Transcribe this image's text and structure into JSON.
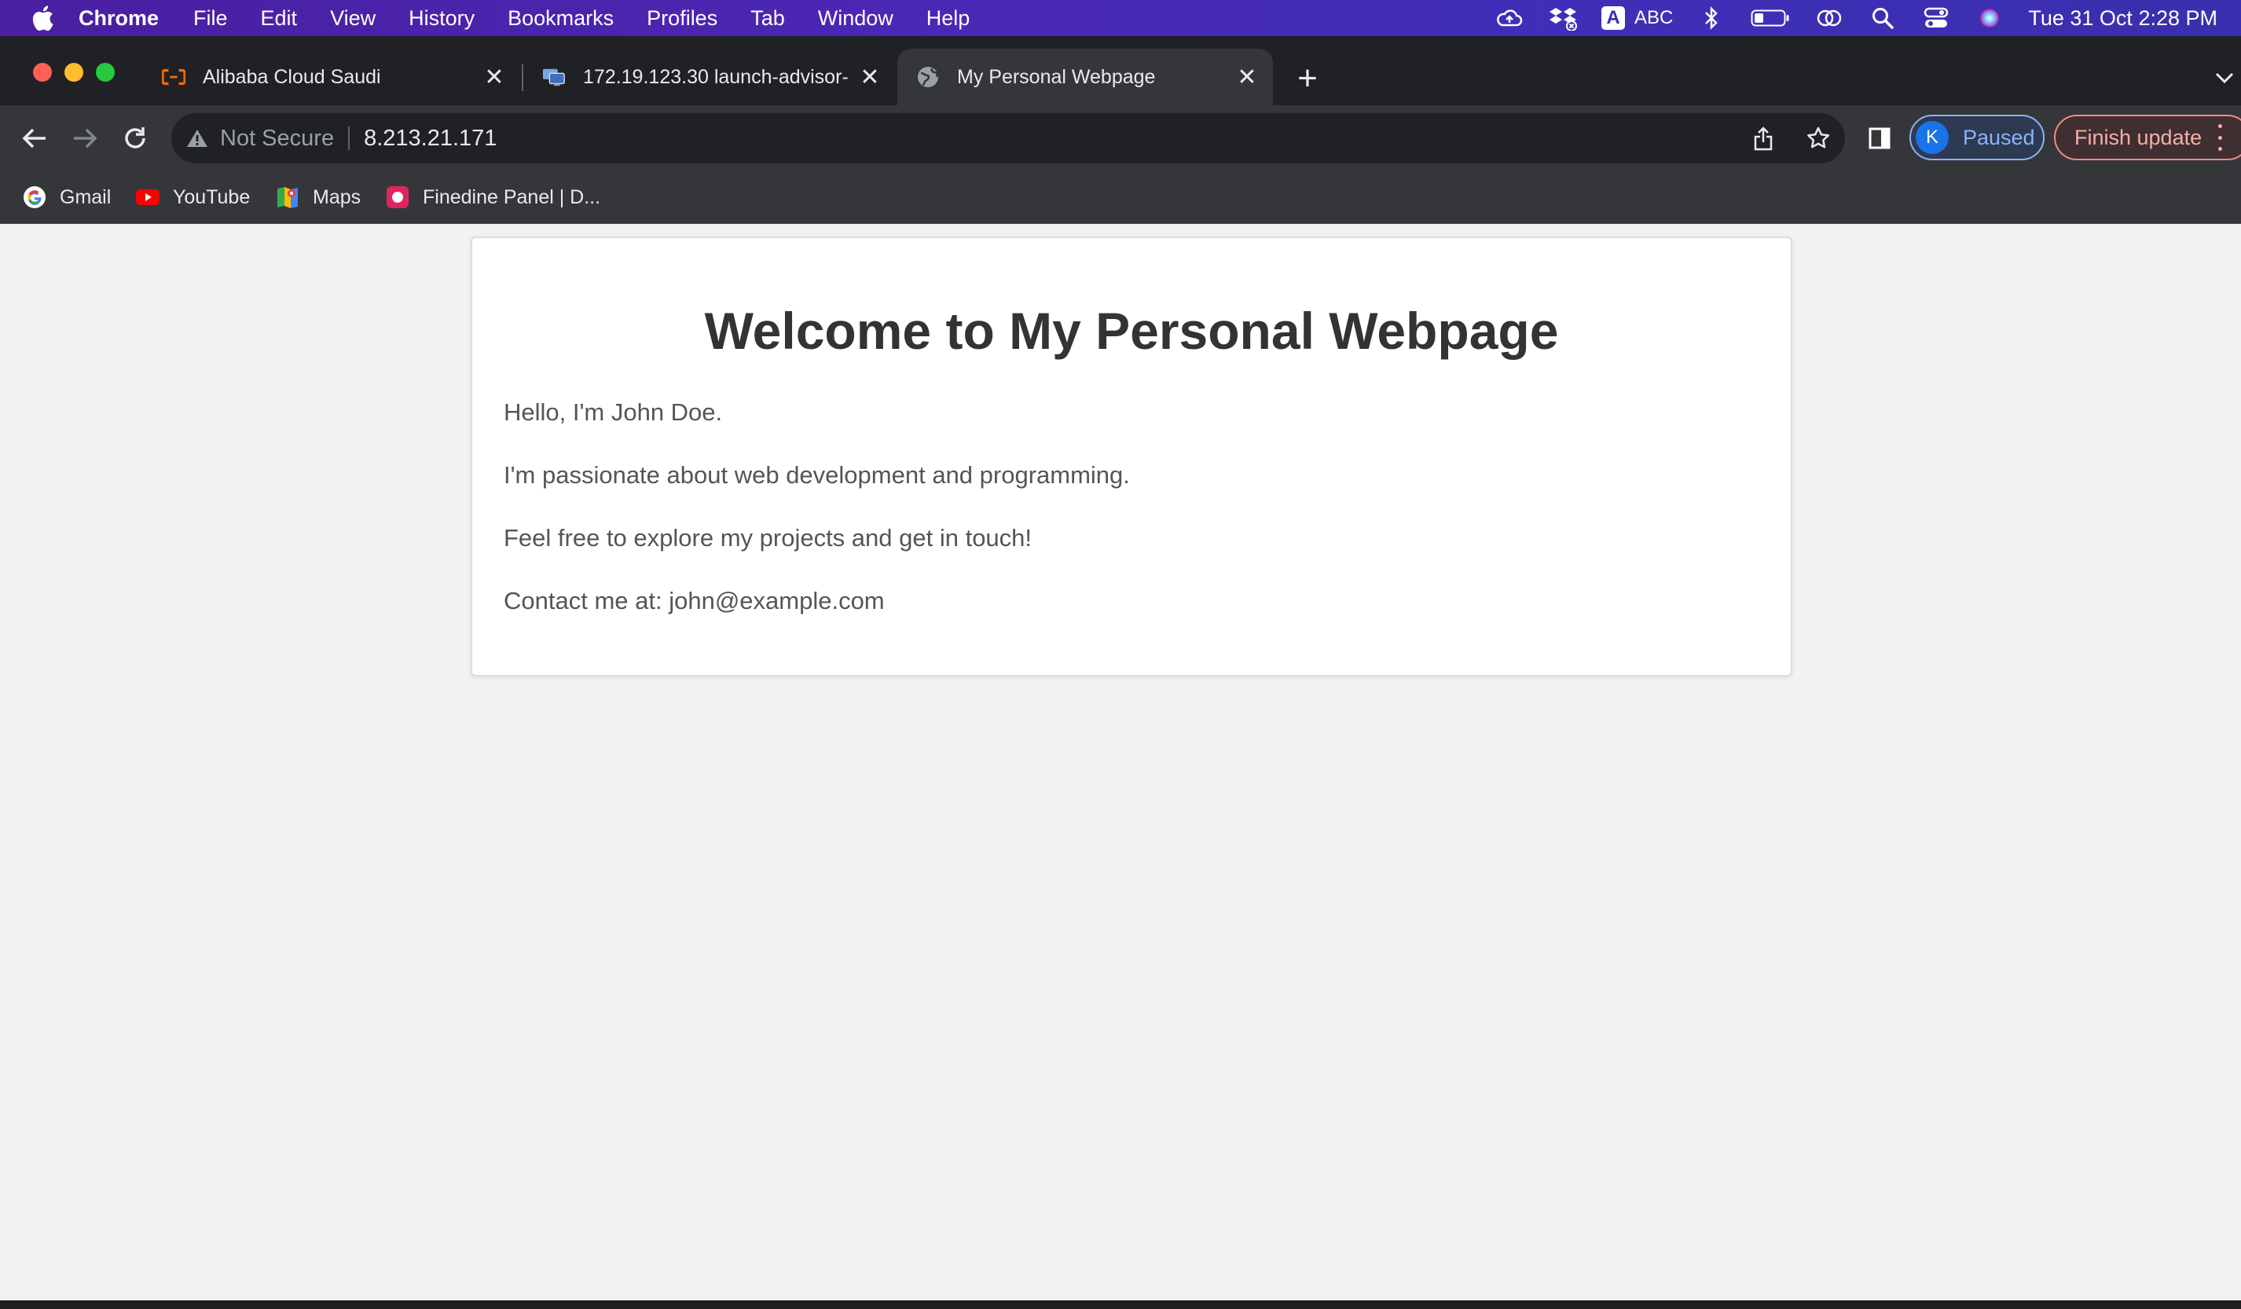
{
  "menubar": {
    "app_name": "Chrome",
    "menus": [
      "File",
      "Edit",
      "View",
      "History",
      "Bookmarks",
      "Profiles",
      "Tab",
      "Window",
      "Help"
    ],
    "keyboard_input": "ABC",
    "keyboard_badge": "A",
    "datetime": "Tue 31 Oct  2:28 PM"
  },
  "tabs": [
    {
      "title": "Alibaba Cloud Saudi",
      "icon": "alibaba-cloud-icon",
      "active": false
    },
    {
      "title": "172.19.123.30 launch-advisor-",
      "icon": "remote-desktop-icon",
      "active": false
    },
    {
      "title": "My Personal Webpage",
      "icon": "globe-icon",
      "active": true
    }
  ],
  "omnibox": {
    "security_label": "Not Secure",
    "url": "8.213.21.171"
  },
  "profile": {
    "initial": "K",
    "status": "Paused"
  },
  "update_button": "Finish update",
  "bookmarks": [
    {
      "label": "Gmail",
      "icon": "google-icon"
    },
    {
      "label": "YouTube",
      "icon": "youtube-icon"
    },
    {
      "label": "Maps",
      "icon": "maps-icon"
    },
    {
      "label": "Finedine Panel | D...",
      "icon": "finedine-icon"
    }
  ],
  "page": {
    "heading": "Welcome to My Personal Webpage",
    "paragraphs": [
      "Hello, I'm John Doe.",
      "I'm passionate about web development and programming.",
      "Feel free to explore my projects and get in touch!",
      "Contact me at: john@example.com"
    ]
  },
  "colors": {
    "page_background": "#f2f2f2",
    "heading_color": "#333333",
    "text_color": "#555555",
    "profile_accent": "#8ab4f8",
    "update_accent": "#f28b82"
  }
}
